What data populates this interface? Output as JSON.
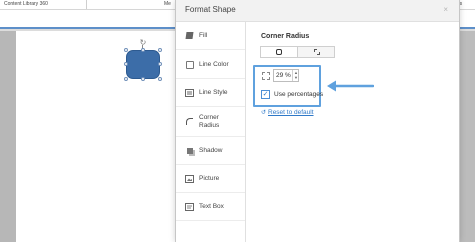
{
  "ribbon": {
    "tabs": [
      "Content Library 360",
      "Me",
      "ects"
    ]
  },
  "dialog": {
    "title": "Format Shape",
    "close_label": "×"
  },
  "nav": {
    "items": [
      {
        "label": "Fill",
        "icon": "fill-icon"
      },
      {
        "label": "Line Color",
        "icon": "line-color-icon"
      },
      {
        "label": "Line Style",
        "icon": "line-style-icon"
      },
      {
        "label": "Corner Radius",
        "icon": "corner-radius-icon",
        "active": true
      },
      {
        "label": "Shadow",
        "icon": "shadow-icon"
      },
      {
        "label": "Picture",
        "icon": "picture-icon"
      },
      {
        "label": "Text Box",
        "icon": "text-box-icon"
      }
    ]
  },
  "corner_radius": {
    "section_title": "Corner Radius",
    "shape_options": [
      "rounded-corners",
      "square-corners"
    ],
    "selected_option": "rounded-corners",
    "radius_value": "29 %",
    "use_percentages_label": "Use percentages",
    "use_percentages_checked": true,
    "reset_label": "Reset to default"
  },
  "colors": {
    "accent": "#5fa1de",
    "shape_fill": "#3c6da8",
    "link": "#2f79c8"
  }
}
